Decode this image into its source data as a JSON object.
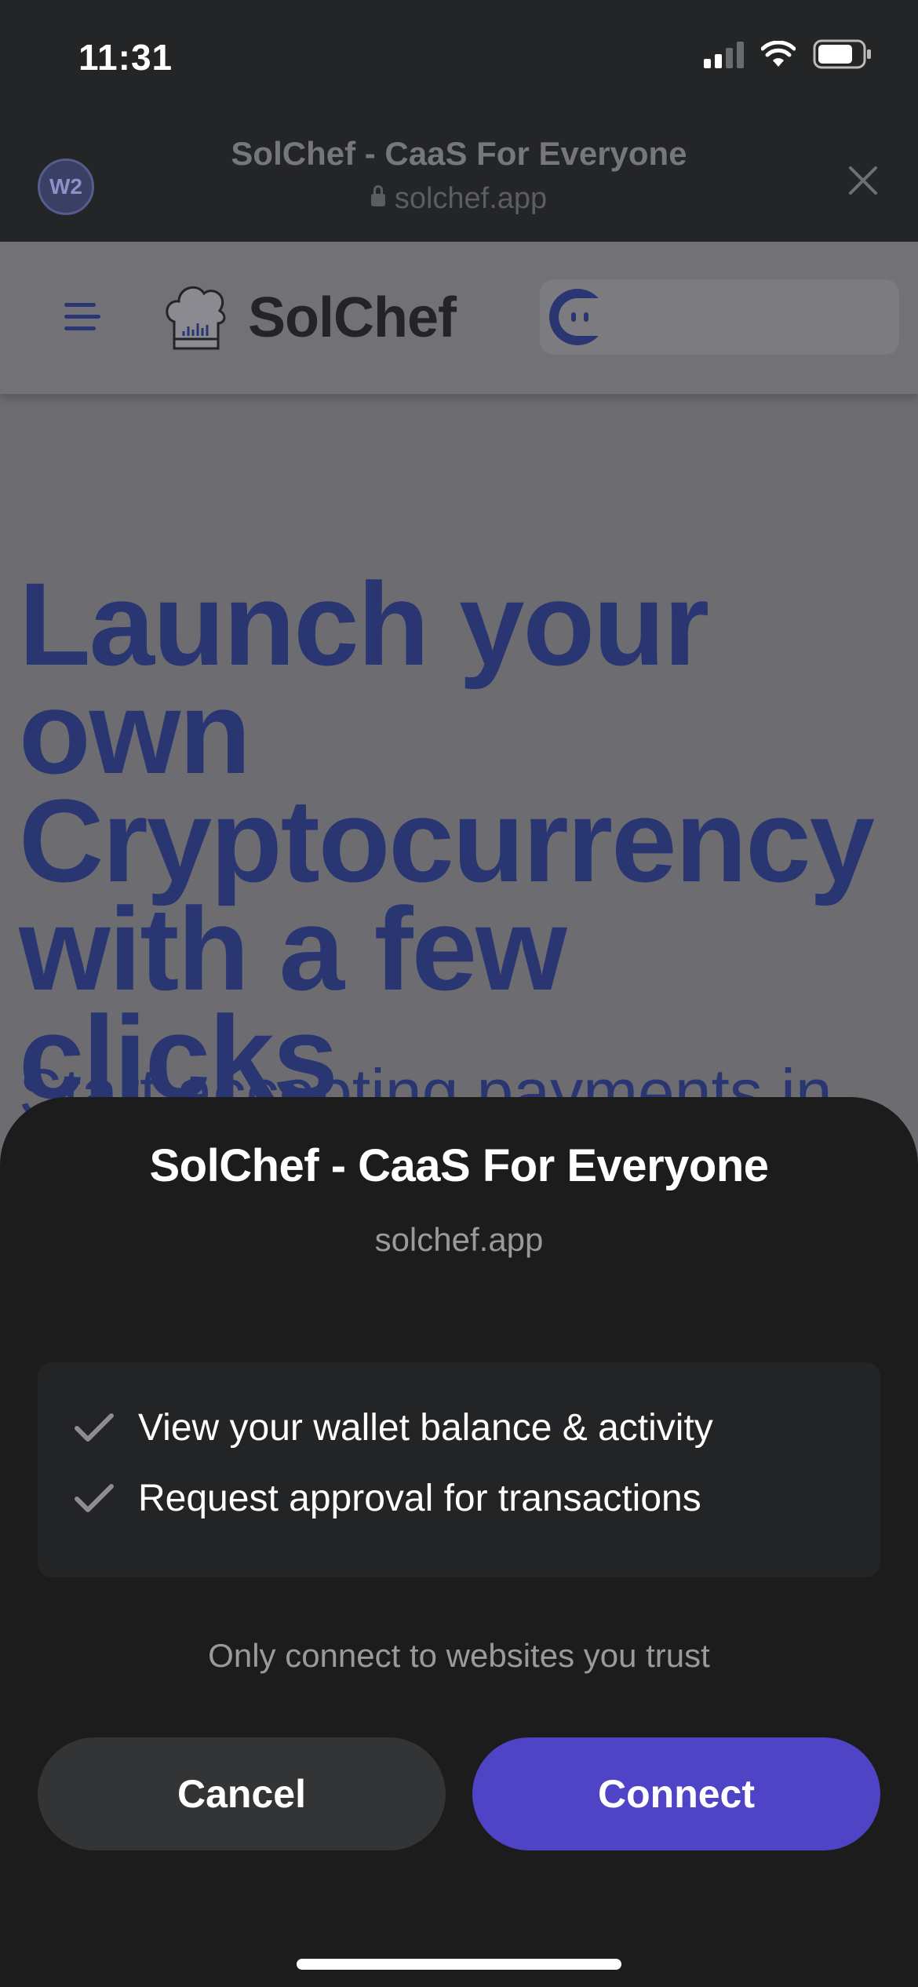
{
  "status_bar": {
    "time": "11:31",
    "signal_bars_filled": 2,
    "battery_level": 0.8
  },
  "browser_header": {
    "wallet_badge": "W2",
    "title": "SolChef - CaaS For Everyone",
    "url": "solchef.app"
  },
  "site": {
    "name": "SolChef",
    "hero_title": "Launch your own Cryptocurrency with a few clicks",
    "hero_subtitle": "Start accepting payments in"
  },
  "sheet": {
    "title": "SolChef - CaaS For Everyone",
    "domain": "solchef.app",
    "permissions": [
      {
        "label": "View your wallet balance & activity",
        "icon": "checkmark-icon"
      },
      {
        "label": "Request approval for transactions",
        "icon": "checkmark-icon"
      }
    ],
    "trust_note": "Only connect to websites you trust",
    "cancel_label": "Cancel",
    "connect_label": "Connect"
  },
  "colors": {
    "accent": "#4f44c6",
    "site_brand": "#2a3672",
    "sheet_bg": "#1c1c1d",
    "overlay_page": "#6c6c71"
  }
}
